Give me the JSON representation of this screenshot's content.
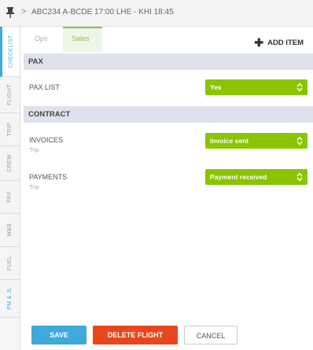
{
  "header": {
    "pin_icon": "pin-icon",
    "chevron": ">",
    "flight_title": "ABC234 A-BCDE 17:00 LHE - KHI 18:45"
  },
  "side_tabs": [
    "CHECKLIST",
    "FLIGHT",
    "TRIP",
    "CREW",
    "PAX",
    "W&B",
    "FUEL",
    "PM & JL"
  ],
  "tabs": {
    "ops": "Ops",
    "sales": "Sales",
    "active": "Sales"
  },
  "add_item": {
    "icon": "plus-icon",
    "label": "ADD ITEM"
  },
  "sections": {
    "pax": {
      "title": "PAX",
      "rows": [
        {
          "label": "PAX LIST",
          "sub": "",
          "value": "Yes"
        }
      ]
    },
    "contract": {
      "title": "CONTRACT",
      "rows": [
        {
          "label": "INVOICES",
          "sub": "Trip",
          "value": "Invoice sent"
        },
        {
          "label": "PAYMENTS",
          "sub": "Trip",
          "value": "Payment received"
        }
      ]
    }
  },
  "buttons": {
    "save": "SAVE",
    "delete": "DELETE FLIGHT",
    "cancel": "CANCEL"
  },
  "colors": {
    "accent_blue": "#3fa9d9",
    "select_green": "#8bc400",
    "delete_red": "#e8471d",
    "section_bg": "#dfe2ea"
  }
}
